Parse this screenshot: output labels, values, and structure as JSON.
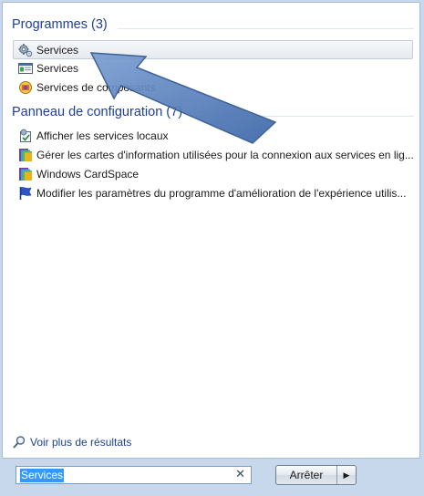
{
  "sections": {
    "programs": {
      "title": "Programmes (3)",
      "items": [
        {
          "label": "Services",
          "icon": "gear-services-icon",
          "selected": true
        },
        {
          "label": "Services",
          "icon": "console-window-icon"
        },
        {
          "label": "Services de composants",
          "icon": "component-services-icon"
        }
      ]
    },
    "control_panel": {
      "title": "Panneau de configuration (7)",
      "items": [
        {
          "label": "Afficher les services locaux",
          "icon": "local-services-icon"
        },
        {
          "label": "Gérer les cartes d'information utilisées pour la connexion aux services en lig...",
          "icon": "cardspace-icon"
        },
        {
          "label": "Windows CardSpace",
          "icon": "cardspace-icon"
        },
        {
          "label": "Modifier les paramètres du programme d'amélioration de l'expérience utilis...",
          "icon": "flag-icon"
        }
      ]
    }
  },
  "more_results": "Voir plus de résultats",
  "search": {
    "value": "Services"
  },
  "shutdown_button": {
    "label": "Arrêter"
  }
}
